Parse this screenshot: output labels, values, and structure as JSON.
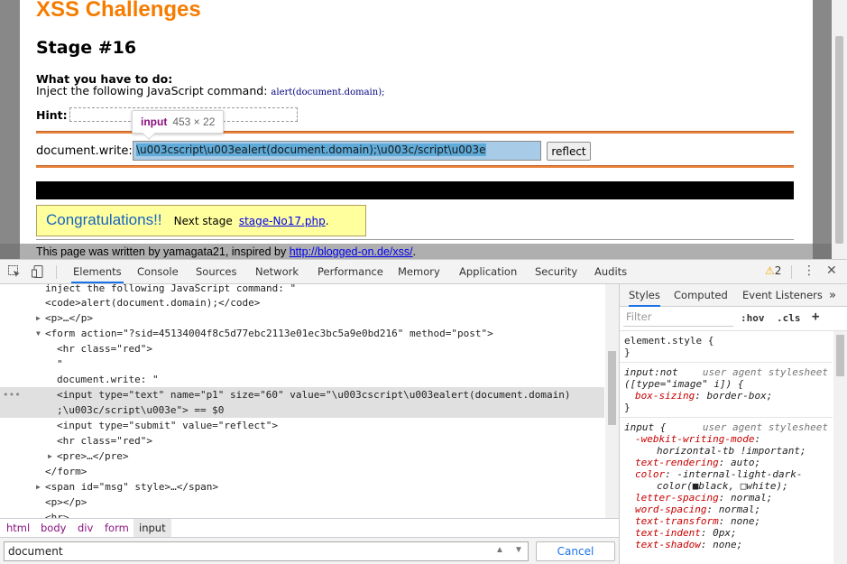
{
  "page": {
    "site_title": "XSS Challenges",
    "stage": "Stage #16",
    "todo_heading": "What you have to do:",
    "todo_text": "Inject the following JavaScript command:",
    "todo_code": "alert(document.domain);",
    "hint_label": "Hint:",
    "docwrite_label": "document.write:",
    "input_value": "\\u003cscript\\u003ealert(document.domain);\\u003c/script\\u003e",
    "reflect_button": "reflect",
    "congrats_big": "Congratulations!!",
    "congrats_small": "Next stage",
    "next_link": "stage-No17.php",
    "congrats_period": ".",
    "footer_text": "This page was written by yamagata21, inspired by",
    "footer_link": "http://blogged-on.de/xss/",
    "footer_period": "."
  },
  "tooltip": {
    "tag": "input",
    "dims": "453 × 22"
  },
  "devtools": {
    "tabs": [
      "Elements",
      "Console",
      "Sources",
      "Network",
      "Performance",
      "Memory",
      "Application",
      "Security",
      "Audits"
    ],
    "warning_count": "2",
    "elements": [
      {
        "t": "inject the following JavaScript command: \""
      },
      {
        "t": "<code>alert(document.domain);</code>"
      },
      {
        "t": "<p>…</p>"
      },
      {
        "t": "<form action=\"?sid=45134004f8c5d77ebc2113e01ec3bc5a9e0bd216\" method=\"post\">"
      },
      {
        "t": "<hr class=\"red\">"
      },
      {
        "t": "\""
      },
      {
        "t": "document.write: \""
      },
      {
        "t": "<input type=\"text\" name=\"p1\" size=\"60\" value=\"\\u003cscript\\u003ealert(document.domain)"
      },
      {
        "t": ";\\u003c/script\\u003e\"> == $0"
      },
      {
        "t": "<input type=\"submit\" value=\"reflect\">"
      },
      {
        "t": "<hr class=\"red\">"
      },
      {
        "t": "<pre>…</pre>"
      },
      {
        "t": "</form>"
      },
      {
        "t": "<span id=\"msg\" style>…</span>"
      },
      {
        "t": "<p></p>"
      },
      {
        "t": "<hr>"
      }
    ],
    "breadcrumbs": [
      "html",
      "body",
      "div",
      "form",
      "input"
    ],
    "search_value": "document",
    "cancel_label": "Cancel",
    "styles_tabs": [
      "Styles",
      "Computed",
      "Event Listeners"
    ],
    "filter_placeholder": "Filter",
    "hov": ":hov",
    "cls": ".cls",
    "rules": {
      "r1_sel": "element.style {",
      "r1_close": "}",
      "r2_sel": "input:not",
      "r2_origin": "user agent stylesheet",
      "r2_sel2": "([type=\"image\" i]) {",
      "r2_p1n": "box-sizing",
      "r2_p1v": "border-box;",
      "r2_close": "}",
      "r3_sel": "input {",
      "r3_origin": "user agent stylesheet",
      "props": [
        {
          "n": "-webkit-writing-mode",
          "v": ""
        },
        {
          "n": "",
          "v": "horizontal-tb !important;"
        },
        {
          "n": "text-rendering",
          "v": "auto;"
        },
        {
          "n": "color",
          "v": "-internal-light-dark-"
        },
        {
          "n": "",
          "v": "color(■black, □white);"
        },
        {
          "n": "letter-spacing",
          "v": "normal;"
        },
        {
          "n": "word-spacing",
          "v": "normal;"
        },
        {
          "n": "text-transform",
          "v": "none;"
        },
        {
          "n": "text-indent",
          "v": "0px;"
        },
        {
          "n": "text-shadow",
          "v": "none;"
        }
      ]
    }
  },
  "colors": {
    "title_orange": "#f57c00",
    "accent_blue": "#1a73e8",
    "tag_purple": "#881280"
  }
}
